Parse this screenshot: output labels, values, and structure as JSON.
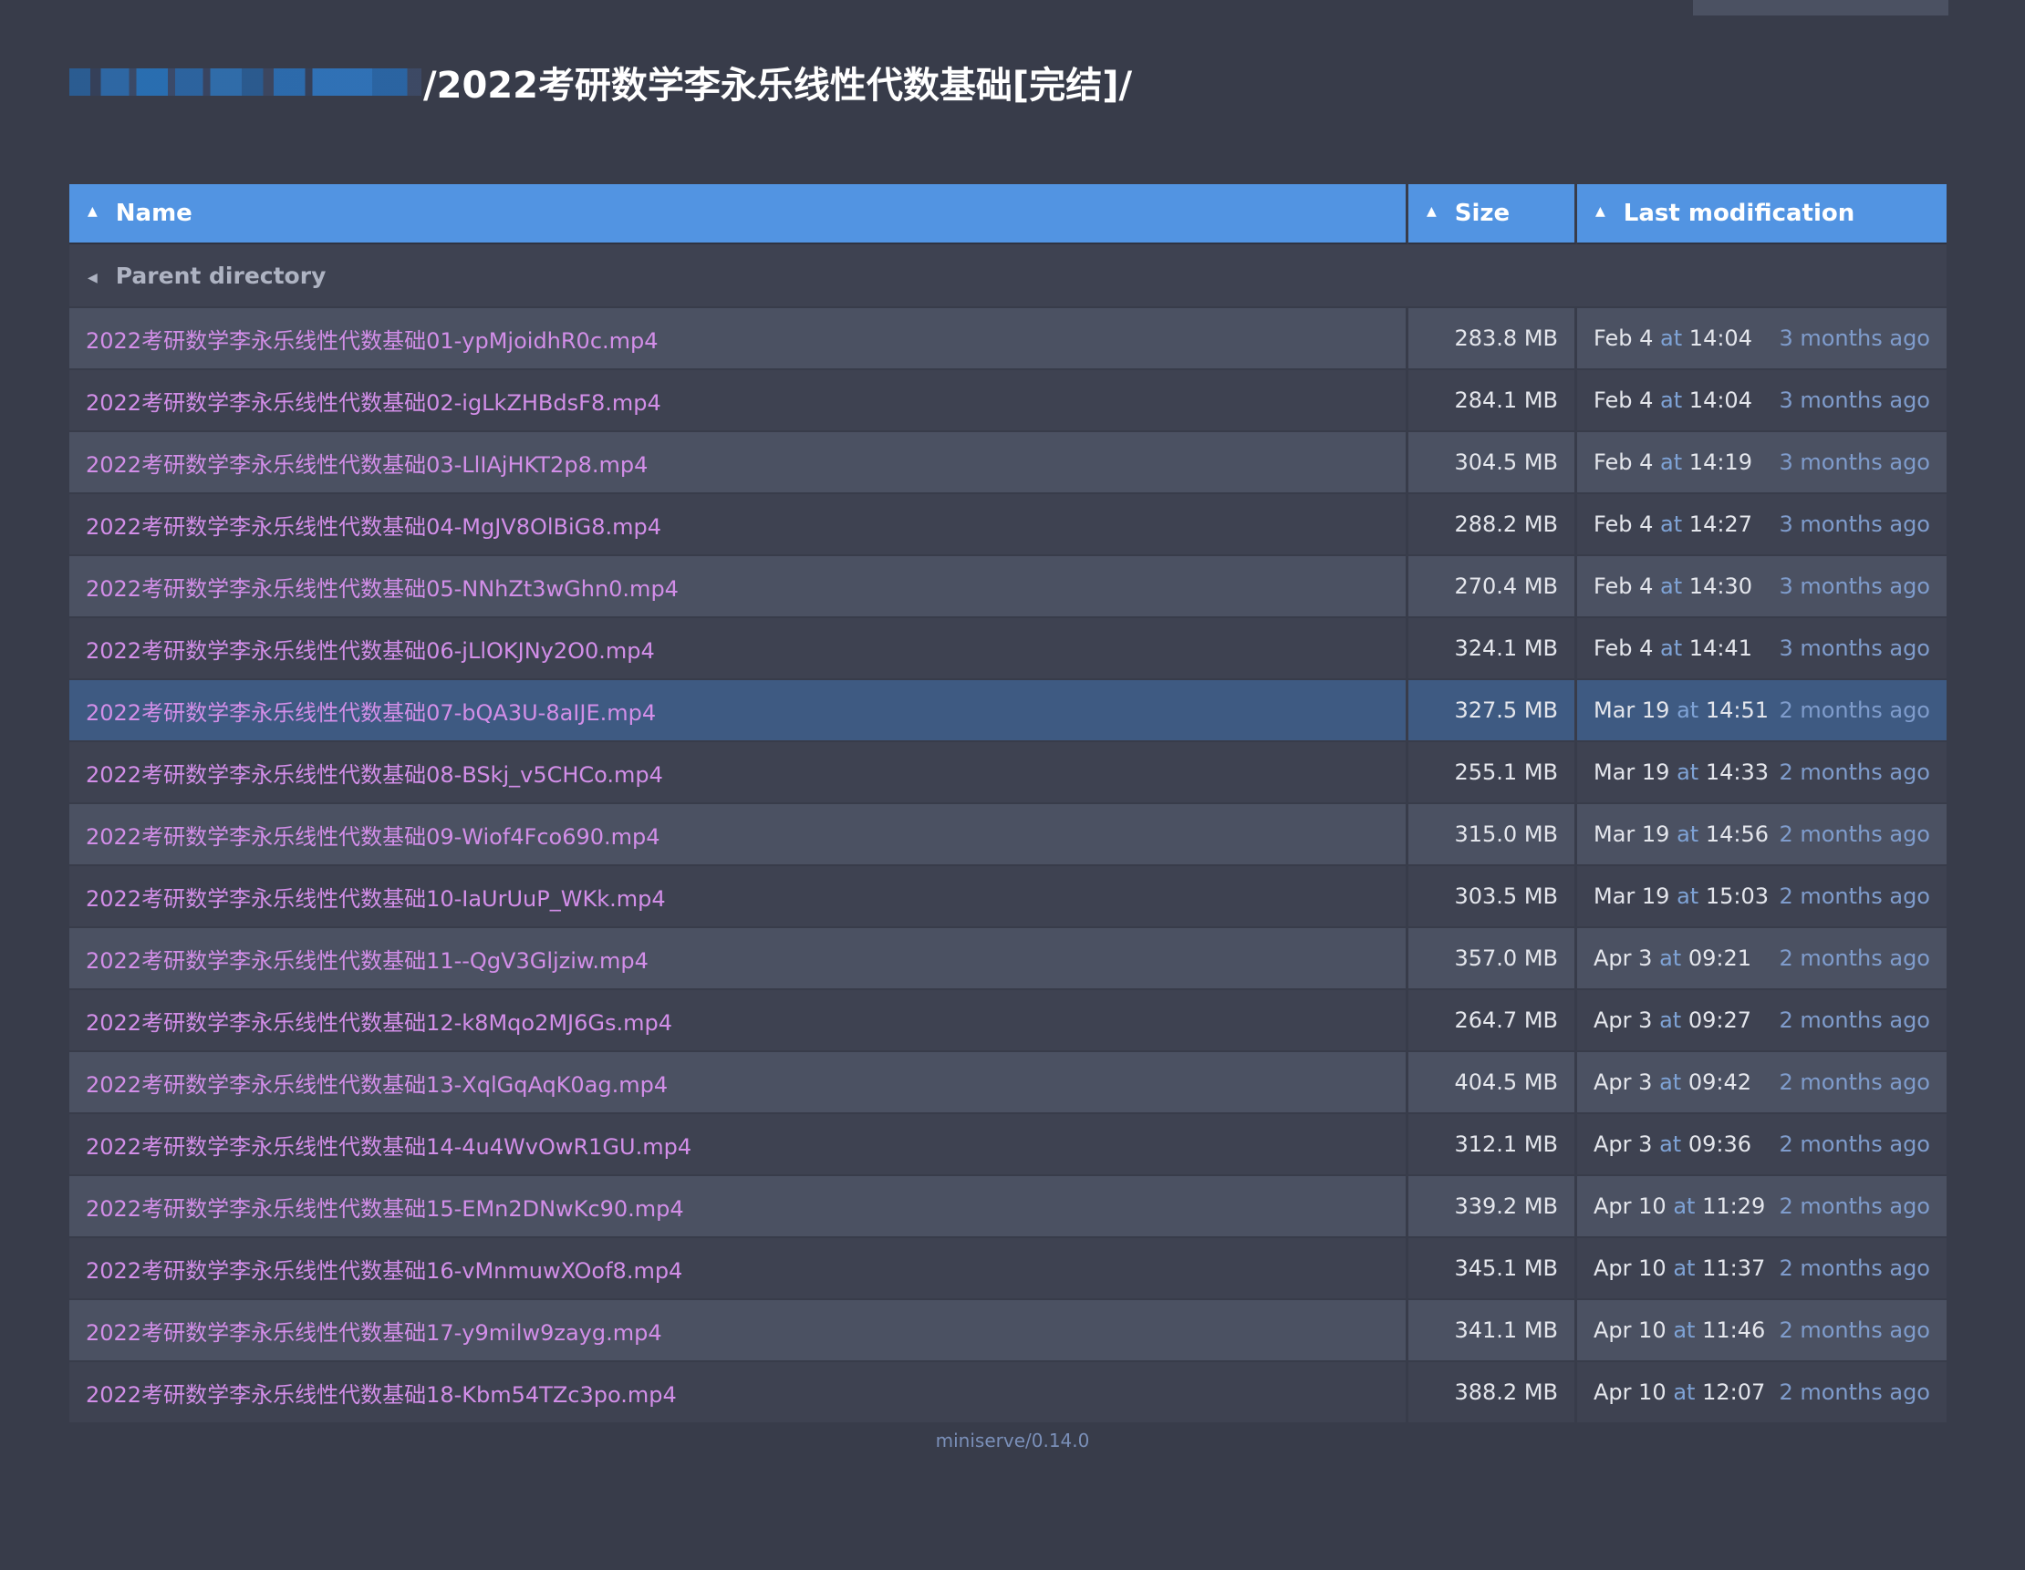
{
  "page": {
    "title_path": "/2022考研数学李永乐线性代数基础[完结]/",
    "footer": "miniserve/0.14.0"
  },
  "table": {
    "headers": {
      "name": "Name",
      "size": "Size",
      "modified": "Last modification"
    },
    "parent_label": "Parent directory",
    "at_word": "at",
    "rows": [
      {
        "name": "2022考研数学李永乐线性代数基础01-ypMjoidhR0c.mp4",
        "size": "283.8 MB",
        "date": "Feb 4",
        "time": "14:04",
        "ago": "3 months ago"
      },
      {
        "name": "2022考研数学李永乐线性代数基础02-igLkZHBdsF8.mp4",
        "size": "284.1 MB",
        "date": "Feb 4",
        "time": "14:04",
        "ago": "3 months ago"
      },
      {
        "name": "2022考研数学李永乐线性代数基础03-LlIAjHKT2p8.mp4",
        "size": "304.5 MB",
        "date": "Feb 4",
        "time": "14:19",
        "ago": "3 months ago"
      },
      {
        "name": "2022考研数学李永乐线性代数基础04-MgJV8OlBiG8.mp4",
        "size": "288.2 MB",
        "date": "Feb 4",
        "time": "14:27",
        "ago": "3 months ago"
      },
      {
        "name": "2022考研数学李永乐线性代数基础05-NNhZt3wGhn0.mp4",
        "size": "270.4 MB",
        "date": "Feb 4",
        "time": "14:30",
        "ago": "3 months ago"
      },
      {
        "name": "2022考研数学李永乐线性代数基础06-jLlOKJNy2O0.mp4",
        "size": "324.1 MB",
        "date": "Feb 4",
        "time": "14:41",
        "ago": "3 months ago"
      },
      {
        "name": "2022考研数学李永乐线性代数基础07-bQA3U-8aIJE.mp4",
        "size": "327.5 MB",
        "date": "Mar 19",
        "time": "14:51",
        "ago": "2 months ago",
        "selected": true
      },
      {
        "name": "2022考研数学李永乐线性代数基础08-BSkj_v5CHCo.mp4",
        "size": "255.1 MB",
        "date": "Mar 19",
        "time": "14:33",
        "ago": "2 months ago"
      },
      {
        "name": "2022考研数学李永乐线性代数基础09-Wiof4Fco690.mp4",
        "size": "315.0 MB",
        "date": "Mar 19",
        "time": "14:56",
        "ago": "2 months ago"
      },
      {
        "name": "2022考研数学李永乐线性代数基础10-IaUrUuP_WKk.mp4",
        "size": "303.5 MB",
        "date": "Mar 19",
        "time": "15:03",
        "ago": "2 months ago"
      },
      {
        "name": "2022考研数学李永乐线性代数基础11--QgV3Gljziw.mp4",
        "size": "357.0 MB",
        "date": "Apr 3",
        "time": "09:21",
        "ago": "2 months ago"
      },
      {
        "name": "2022考研数学李永乐线性代数基础12-k8Mqo2MJ6Gs.mp4",
        "size": "264.7 MB",
        "date": "Apr 3",
        "time": "09:27",
        "ago": "2 months ago"
      },
      {
        "name": "2022考研数学李永乐线性代数基础13-XqlGqAqK0ag.mp4",
        "size": "404.5 MB",
        "date": "Apr 3",
        "time": "09:42",
        "ago": "2 months ago"
      },
      {
        "name": "2022考研数学李永乐线性代数基础14-4u4WvOwR1GU.mp4",
        "size": "312.1 MB",
        "date": "Apr 3",
        "time": "09:36",
        "ago": "2 months ago"
      },
      {
        "name": "2022考研数学李永乐线性代数基础15-EMn2DNwKc90.mp4",
        "size": "339.2 MB",
        "date": "Apr 10",
        "time": "11:29",
        "ago": "2 months ago"
      },
      {
        "name": "2022考研数学李永乐线性代数基础16-vMnmuwXOof8.mp4",
        "size": "345.1 MB",
        "date": "Apr 10",
        "time": "11:37",
        "ago": "2 months ago"
      },
      {
        "name": "2022考研数学李永乐线性代数基础17-y9milw9zayg.mp4",
        "size": "341.1 MB",
        "date": "Apr 10",
        "time": "11:46",
        "ago": "2 months ago"
      },
      {
        "name": "2022考研数学李永乐线性代数基础18-Kbm54TZc3po.mp4",
        "size": "388.2 MB",
        "date": "Apr 10",
        "time": "12:07",
        "ago": "2 months ago"
      }
    ]
  },
  "colors": {
    "background": "#383c4a",
    "header": "#5294e2",
    "link": "#d28ee8",
    "selected_row": "#3e5a82"
  }
}
